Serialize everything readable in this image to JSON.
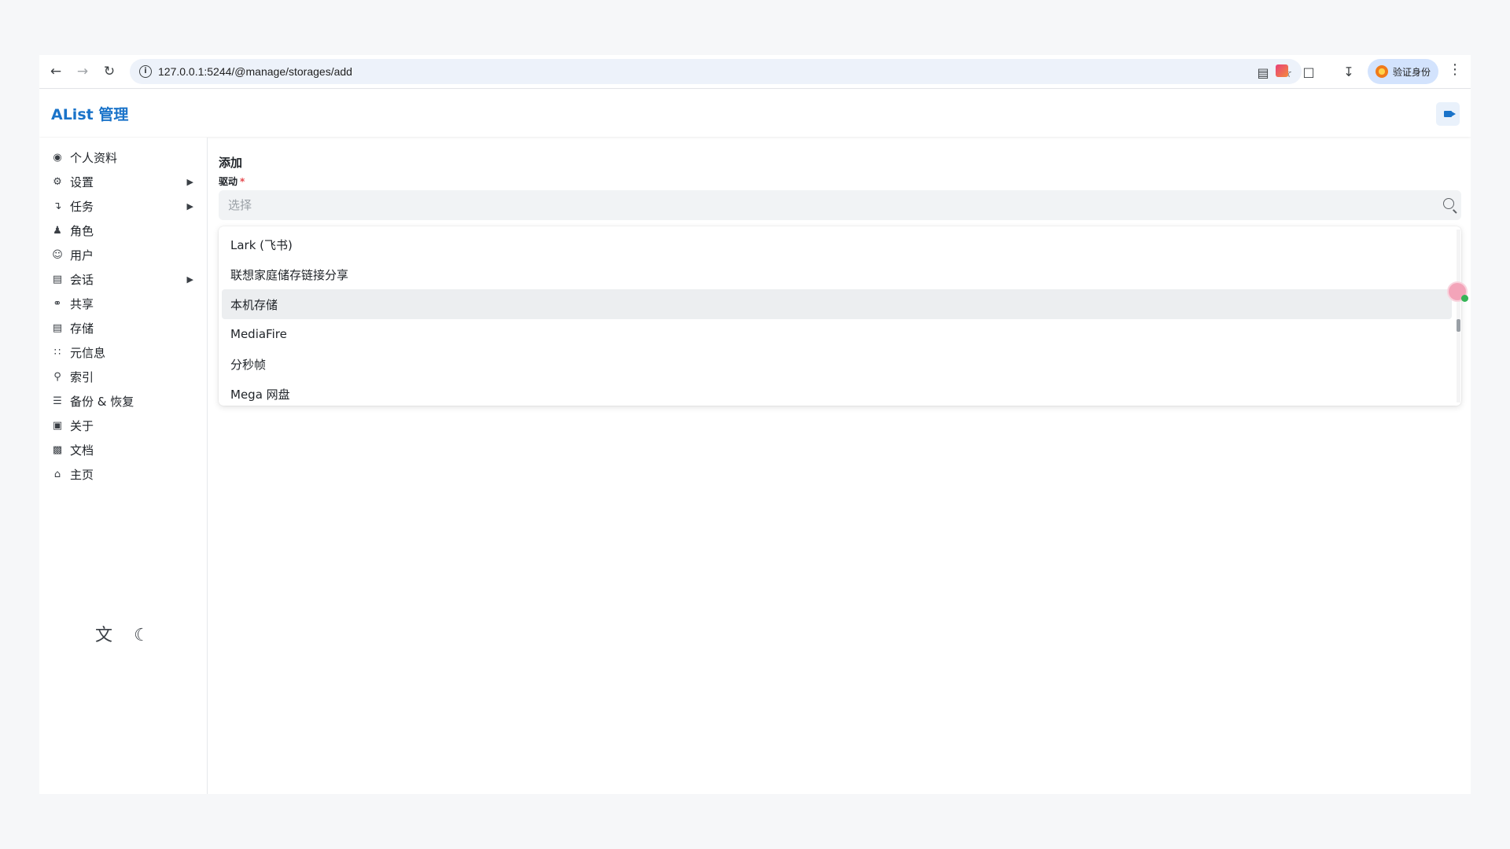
{
  "browser": {
    "url": "127.0.0.1:5244/@manage/storages/add",
    "profile_label": "验证身份"
  },
  "app": {
    "title": "AList 管理"
  },
  "sidebar": {
    "items": [
      {
        "label": "个人资料",
        "icon": "profile-icon",
        "has_submenu": false
      },
      {
        "label": "设置",
        "icon": "gear-icon",
        "has_submenu": true
      },
      {
        "label": "任务",
        "icon": "tasks-icon",
        "has_submenu": true
      },
      {
        "label": "角色",
        "icon": "roles-icon",
        "has_submenu": false
      },
      {
        "label": "用户",
        "icon": "user-icon",
        "has_submenu": false
      },
      {
        "label": "会话",
        "icon": "session-icon",
        "has_submenu": true
      },
      {
        "label": "共享",
        "icon": "link-icon",
        "has_submenu": false
      },
      {
        "label": "存储",
        "icon": "storage-icon",
        "has_submenu": false
      },
      {
        "label": "元信息",
        "icon": "meta-icon",
        "has_submenu": false
      },
      {
        "label": "索引",
        "icon": "search-icon",
        "has_submenu": false
      },
      {
        "label": "备份 & 恢复",
        "icon": "database-icon",
        "has_submenu": false
      },
      {
        "label": "关于",
        "icon": "about-icon",
        "has_submenu": false
      },
      {
        "label": "文档",
        "icon": "book-icon",
        "has_submenu": false
      },
      {
        "label": "主页",
        "icon": "home-icon",
        "has_submenu": false
      }
    ]
  },
  "main": {
    "heading": "添加",
    "driver_label": "驱动",
    "required_mark": "*",
    "select_placeholder": "选择",
    "options": [
      "Lark (飞书)",
      "联想家庭储存链接分享",
      "本机存储",
      "MediaFire",
      "分秒帧",
      "Mega 网盘"
    ],
    "highlighted_option": "本机存储"
  }
}
